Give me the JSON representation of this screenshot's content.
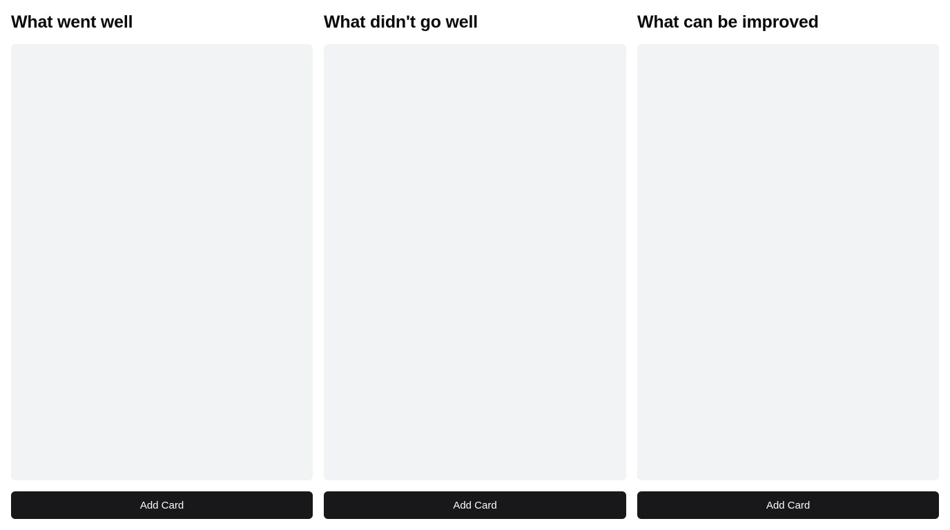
{
  "columns": [
    {
      "title": "What went well",
      "add_button_label": "Add Card"
    },
    {
      "title": "What didn't go well",
      "add_button_label": "Add Card"
    },
    {
      "title": "What can be improved",
      "add_button_label": "Add Card"
    }
  ],
  "colors": {
    "card_area_background": "#f2f3f5",
    "button_background": "#18181b",
    "button_text": "#fafafa",
    "heading_text": "#0a0a0a"
  }
}
